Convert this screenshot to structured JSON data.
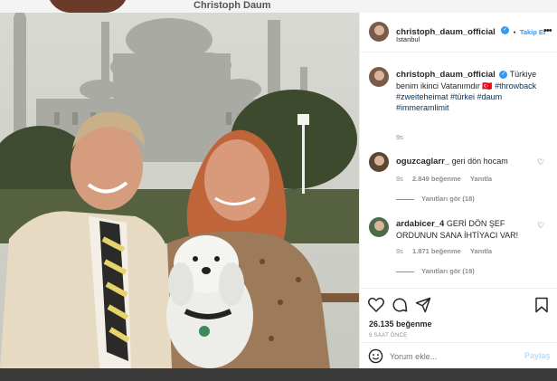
{
  "top": {
    "name": "Christoph Daum"
  },
  "post": {
    "username": "christoph_daum_official",
    "follow_label": "Takip Et",
    "location": "İstanbul",
    "caption": {
      "username": "christoph_daum_official",
      "text": "Türkiye benim ikinci Vatanımdır 🇹🇷",
      "tags": "#throwback #zweiteheimat #türkei #daum #immeramlimit",
      "age": "9s"
    },
    "comments": [
      {
        "username": "oguzcaglarr_",
        "text": "geri dön hocam",
        "age": "9s",
        "likes": "2.849 beğenme",
        "reply": "Yanıtla",
        "replies": "Yanıtları gör (18)"
      },
      {
        "username": "ardabicer_4",
        "text": "GERİ DÖN ŞEF ORDUNUN SANA İHTİYACI VAR!",
        "age": "9s",
        "likes": "1.871 beğenme",
        "reply": "Yanıtla",
        "replies": "Yanıtları gör (19)"
      }
    ],
    "likes": "26.135 beğenme",
    "timestamp": "9 SAAT ÖNCE",
    "comment_placeholder": "Yorum ekle...",
    "post_button": "Paylaş"
  },
  "colors": {
    "accent": "#3897f0",
    "link": "#00376b",
    "muted": "#8e8e8e"
  },
  "icons": [
    "heart-icon",
    "comment-icon",
    "share-icon",
    "bookmark-icon",
    "emoji-icon",
    "more-icon",
    "verified-icon"
  ]
}
